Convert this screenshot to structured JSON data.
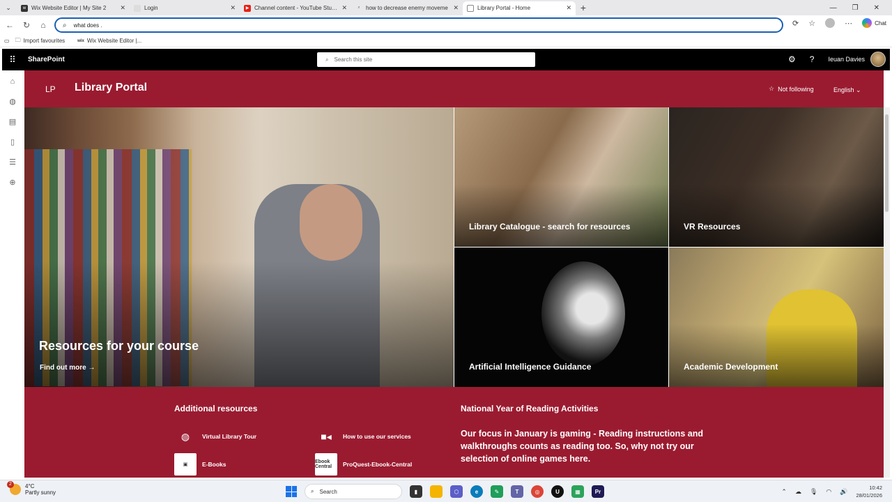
{
  "browser": {
    "tabs": [
      {
        "title": "Wix Website Editor | My Site 2",
        "favicon": "wix",
        "active": false
      },
      {
        "title": "Login",
        "favicon": "page",
        "active": false
      },
      {
        "title": "Channel content - YouTube Studio",
        "favicon": "youtube",
        "active": false
      },
      {
        "title": "how to decrease enemy moveme",
        "favicon": "search",
        "active": false
      },
      {
        "title": "Library Portal - Home",
        "favicon": "page",
        "active": true
      }
    ],
    "address_value": "what does .",
    "chat_label": "Chat",
    "favourites": [
      {
        "label": "Import favourites"
      },
      {
        "label": "Wix Website Editor |..."
      }
    ]
  },
  "suite": {
    "brand": "SharePoint",
    "search_placeholder": "Search this site",
    "user_name": "Ieuan Davies"
  },
  "site": {
    "logo_text": "LP",
    "title": "Library Portal",
    "follow_label": "Not following",
    "language": "English"
  },
  "hero": {
    "main": {
      "title": "Resources for your course",
      "link": "Find out more"
    },
    "tiles": [
      {
        "caption": "Library Catalogue - search for resources"
      },
      {
        "caption": "VR Resources"
      },
      {
        "caption": "Artificial Intelligence Guidance"
      },
      {
        "caption": "Academic Development"
      }
    ]
  },
  "additional": {
    "heading": "Additional resources",
    "links": [
      {
        "label": "Virtual Library Tour",
        "icon": "globe-icon"
      },
      {
        "label": "How to use our services",
        "icon": "video-icon"
      },
      {
        "label": "E-Books",
        "icon": "ereader-icon"
      },
      {
        "label": "ProQuest-Ebook-Central",
        "icon": "proquest-icon",
        "icon_text": "Ebook Central"
      }
    ]
  },
  "nyr": {
    "heading": "National Year of Reading Activities",
    "text": "Our focus in January is gaming - Reading instructions and walkthroughs counts as reading too. So, why not try our selection of online games here."
  },
  "taskbar": {
    "weather_temp": "4°C",
    "weather_desc": "Partly sunny",
    "weather_badge": "2",
    "search_label": "Search",
    "time": "10:42",
    "date": "28/01/2026"
  },
  "colors": {
    "brand": "#9a1b30",
    "suite": "#000000",
    "accent": "#1a5fb4"
  }
}
